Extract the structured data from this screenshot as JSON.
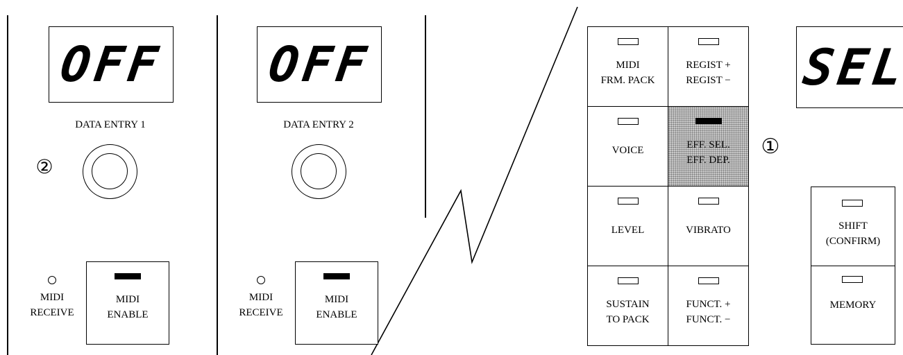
{
  "panel1": {
    "display": "OFF",
    "knob_label": "DATA ENTRY 1",
    "marker": "②",
    "midi_receive": [
      "MIDI",
      "RECEIVE"
    ],
    "midi_enable": [
      "MIDI",
      "ENABLE"
    ]
  },
  "panel2": {
    "display": "OFF",
    "knob_label": "DATA ENTRY 2",
    "midi_receive": [
      "MIDI",
      "RECEIVE"
    ],
    "midi_enable": [
      "MIDI",
      "ENABLE"
    ]
  },
  "grid": {
    "cells": [
      {
        "lines": [
          "MIDI",
          "FRM. PACK"
        ],
        "shaded": false,
        "led": "off"
      },
      {
        "lines": [
          "REGIST +",
          "REGIST −"
        ],
        "shaded": false,
        "led": "off"
      },
      {
        "lines": [
          "VOICE"
        ],
        "shaded": false,
        "led": "off"
      },
      {
        "lines": [
          "EFF. SEL.",
          "EFF. DEP."
        ],
        "shaded": true,
        "led": "on"
      },
      {
        "lines": [
          "LEVEL"
        ],
        "shaded": false,
        "led": "off"
      },
      {
        "lines": [
          "VIBRATO"
        ],
        "shaded": false,
        "led": "off"
      },
      {
        "lines": [
          "SUSTAIN",
          "TO PACK"
        ],
        "shaded": false,
        "led": "off"
      },
      {
        "lines": [
          "FUNCT. +",
          "FUNCT. −"
        ],
        "shaded": false,
        "led": "off"
      }
    ],
    "marker": "①"
  },
  "right": {
    "display": "SEL",
    "shift": [
      "SHIFT",
      "(CONFIRM)"
    ],
    "memory": [
      "MEMORY"
    ]
  }
}
